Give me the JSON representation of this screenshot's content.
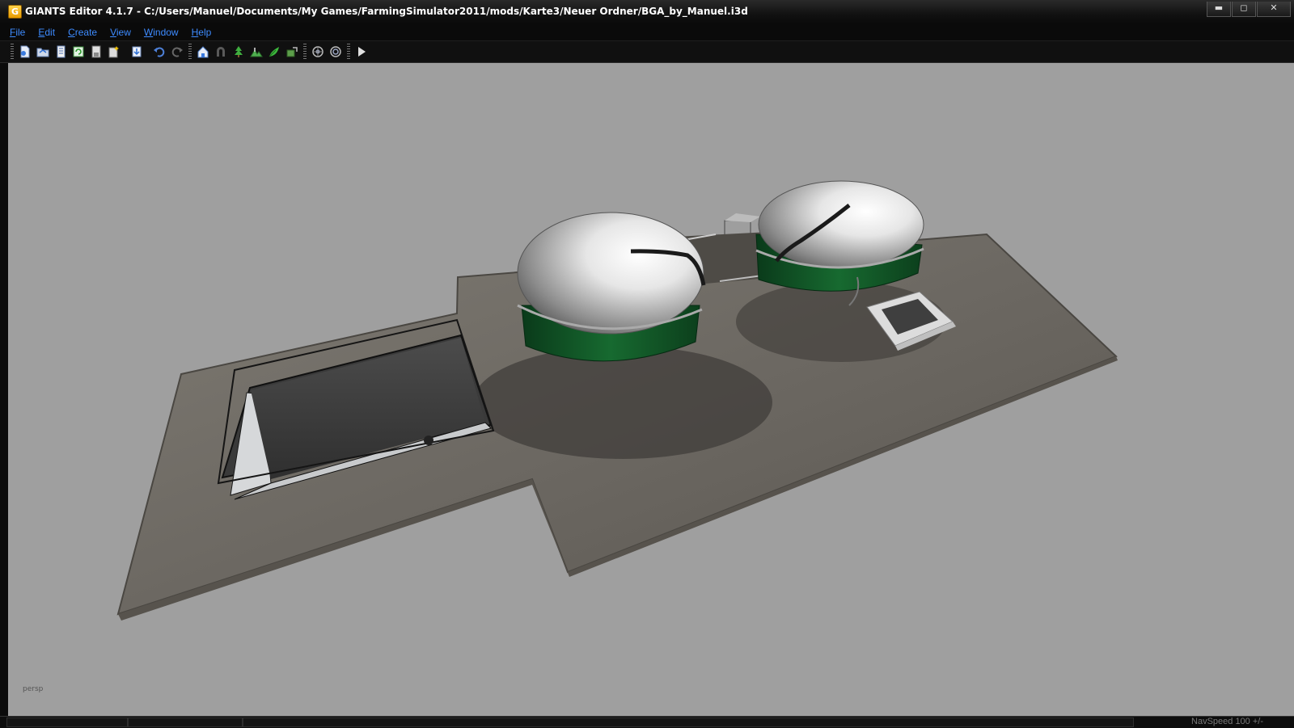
{
  "window": {
    "title": "GIANTS Editor 4.1.7 - C:/Users/Manuel/Documents/My Games/FarmingSimulator2011/mods/Karte3/Neuer Ordner/BGA_by_Manuel.i3d",
    "app_icon_letter": "G",
    "controls": {
      "minimize": "▬",
      "maximize": "◻",
      "close": "✕"
    }
  },
  "menu": [
    {
      "underline": "F",
      "rest": "ile"
    },
    {
      "underline": "E",
      "rest": "dit"
    },
    {
      "underline": "C",
      "rest": "reate"
    },
    {
      "underline": "V",
      "rest": "iew"
    },
    {
      "underline": "W",
      "rest": "indow"
    },
    {
      "underline": "H",
      "rest": "elp"
    }
  ],
  "toolbar": {
    "groups": [
      [
        "new-file-icon",
        "open-file-icon",
        "document-icon",
        "refresh-icon",
        "save-icon",
        "save-as-icon",
        "import-icon",
        "undo-icon",
        "redo-icon"
      ],
      [
        "home-icon",
        "magnet-icon",
        "tree-icon",
        "terrain-icon",
        "foliage-icon",
        "paint-icon"
      ],
      [
        "select-icon",
        "transform-icon"
      ],
      [
        "play-icon"
      ]
    ]
  },
  "viewport": {
    "camera_label": "persp",
    "background_color": "#9f9f9f"
  },
  "status": {
    "navspeed": "NavSpeed 100 +/-"
  }
}
